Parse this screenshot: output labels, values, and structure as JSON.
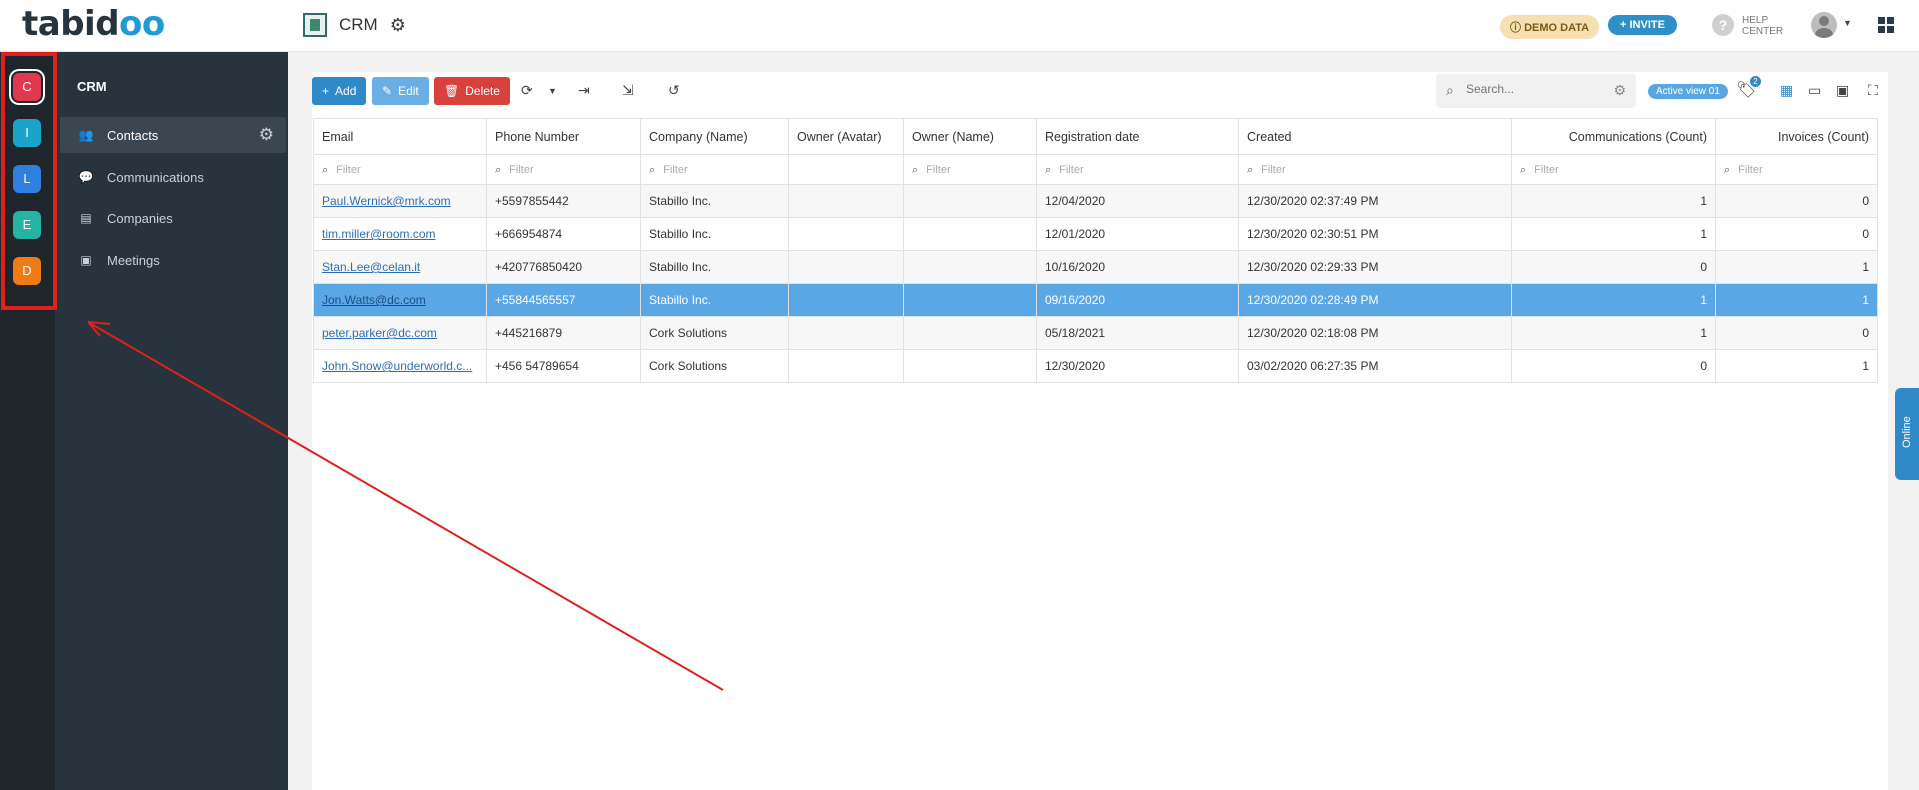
{
  "header": {
    "logo_part1": "tabid",
    "logo_part2": "oo",
    "app_name": "CRM",
    "demo_label": "DEMO DATA",
    "invite_label": "INVITE",
    "help_line1": "HELP",
    "help_line2": "CENTER"
  },
  "workspaces": [
    {
      "letter": "C",
      "color": "#e0394f",
      "active": true
    },
    {
      "letter": "I",
      "color": "#1aa4c9",
      "active": false
    },
    {
      "letter": "L",
      "color": "#2f7fe0",
      "active": false
    },
    {
      "letter": "E",
      "color": "#25b3a4",
      "active": false
    },
    {
      "letter": "D",
      "color": "#f07a14",
      "active": false
    }
  ],
  "sidebar": {
    "title": "CRM",
    "items": [
      {
        "label": "Contacts",
        "icon": "users-icon",
        "active": true
      },
      {
        "label": "Communications",
        "icon": "chat-icon",
        "active": false
      },
      {
        "label": "Companies",
        "icon": "building-icon",
        "active": false
      },
      {
        "label": "Meetings",
        "icon": "calendar-icon",
        "active": false
      }
    ]
  },
  "toolbar": {
    "add_label": "Add",
    "edit_label": "Edit",
    "delete_label": "Delete",
    "search_placeholder": "Search...",
    "active_view": "Active view 01",
    "tag_count": "2"
  },
  "table": {
    "columns": [
      "Email",
      "Phone Number",
      "Company (Name)",
      "Owner (Avatar)",
      "Owner (Name)",
      "Registration date",
      "Created",
      "Communications (Count)",
      "Invoices (Count)"
    ],
    "filter_placeholder": "Filter",
    "rows": [
      {
        "email": "Paul.Wernick@mrk.com",
        "phone": "+5597855442",
        "company": "Stabillo Inc.",
        "avatar": "",
        "owner": "",
        "reg": "12/04/2020",
        "created": "12/30/2020 02:37:49 PM",
        "comms": "1",
        "invoices": "0",
        "selected": false
      },
      {
        "email": "tim.miller@room.com",
        "phone": "+666954874",
        "company": "Stabillo Inc.",
        "avatar": "",
        "owner": "",
        "reg": "12/01/2020",
        "created": "12/30/2020 02:30:51 PM",
        "comms": "1",
        "invoices": "0",
        "selected": false
      },
      {
        "email": "Stan.Lee@celan.it",
        "phone": "+420776850420",
        "company": "Stabillo Inc.",
        "avatar": "",
        "owner": "",
        "reg": "10/16/2020",
        "created": "12/30/2020 02:29:33 PM",
        "comms": "0",
        "invoices": "1",
        "selected": false
      },
      {
        "email": "Jon.Watts@dc.com",
        "phone": "+55844565557",
        "company": "Stabillo Inc.",
        "avatar": "",
        "owner": "",
        "reg": "09/16/2020",
        "created": "12/30/2020 02:28:49 PM",
        "comms": "1",
        "invoices": "1",
        "selected": true
      },
      {
        "email": "peter.parker@dc.com",
        "phone": "+445216879",
        "company": "Cork Solutions",
        "avatar": "",
        "owner": "",
        "reg": "05/18/2021",
        "created": "12/30/2020 02:18:08 PM",
        "comms": "1",
        "invoices": "0",
        "selected": false
      },
      {
        "email": "John.Snow@underworld.c...",
        "phone": "+456 54789654",
        "company": "Cork Solutions",
        "avatar": "",
        "owner": "",
        "reg": "12/30/2020",
        "created": "03/02/2020 06:27:35 PM",
        "comms": "0",
        "invoices": "1",
        "selected": false
      }
    ]
  },
  "online_tab": "Online",
  "colors": {
    "annotation": "#e0201b",
    "accent": "#2f8ac7",
    "selected_row": "#5aa7e6"
  }
}
